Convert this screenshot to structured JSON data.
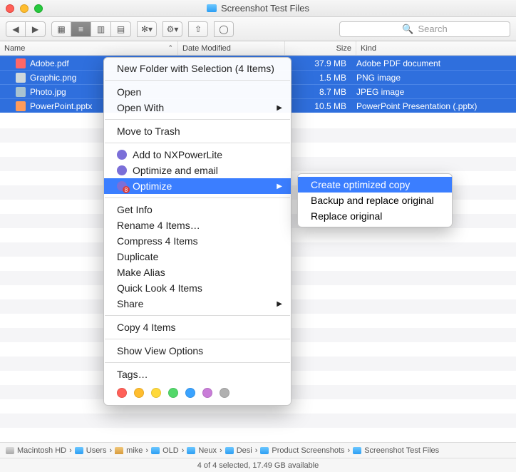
{
  "window": {
    "title": "Screenshot Test Files"
  },
  "toolbar": {
    "search_placeholder": "Search"
  },
  "columns": {
    "name": "Name",
    "date": "Date Modified",
    "size": "Size",
    "kind": "Kind"
  },
  "files": [
    {
      "name": "Adobe.pdf",
      "size": "37.9 MB",
      "kind": "Adobe PDF document",
      "ico": "pdf"
    },
    {
      "name": "Graphic.png",
      "size": "1.5 MB",
      "kind": "PNG image",
      "ico": "png"
    },
    {
      "name": "Photo.jpg",
      "size": "8.7 MB",
      "kind": "JPEG image",
      "ico": "jpg"
    },
    {
      "name": "PowerPoint.pptx",
      "size": "10.5 MB",
      "kind": "PowerPoint Presentation (.pptx)",
      "ico": "pptx"
    }
  ],
  "menu": {
    "new_folder": "New Folder with Selection (4 Items)",
    "open": "Open",
    "open_with": "Open With",
    "trash": "Move to Trash",
    "nxp_add": "Add to NXPowerLite",
    "nxp_email": "Optimize and email",
    "nxp_optimize": "Optimize",
    "get_info": "Get Info",
    "rename": "Rename 4 Items…",
    "compress": "Compress 4 Items",
    "duplicate": "Duplicate",
    "alias": "Make Alias",
    "quicklook": "Quick Look 4 Items",
    "share": "Share",
    "copy": "Copy 4 Items",
    "view_opts": "Show View Options",
    "tags": "Tags…"
  },
  "submenu": {
    "create": "Create optimized copy",
    "backup": "Backup and replace original",
    "replace": "Replace original"
  },
  "tag_colors": [
    "#ff6058",
    "#ffbd2e",
    "#ffd93b",
    "#53d86a",
    "#3aa3ff",
    "#c97dd8",
    "#b0b0b0"
  ],
  "path": [
    "Macintosh HD",
    "Users",
    "mike",
    "OLD",
    "Neux",
    "Desi",
    "Product Screenshots",
    "Screenshot Test Files"
  ],
  "status": "4 of 4 selected, 17.49 GB available"
}
